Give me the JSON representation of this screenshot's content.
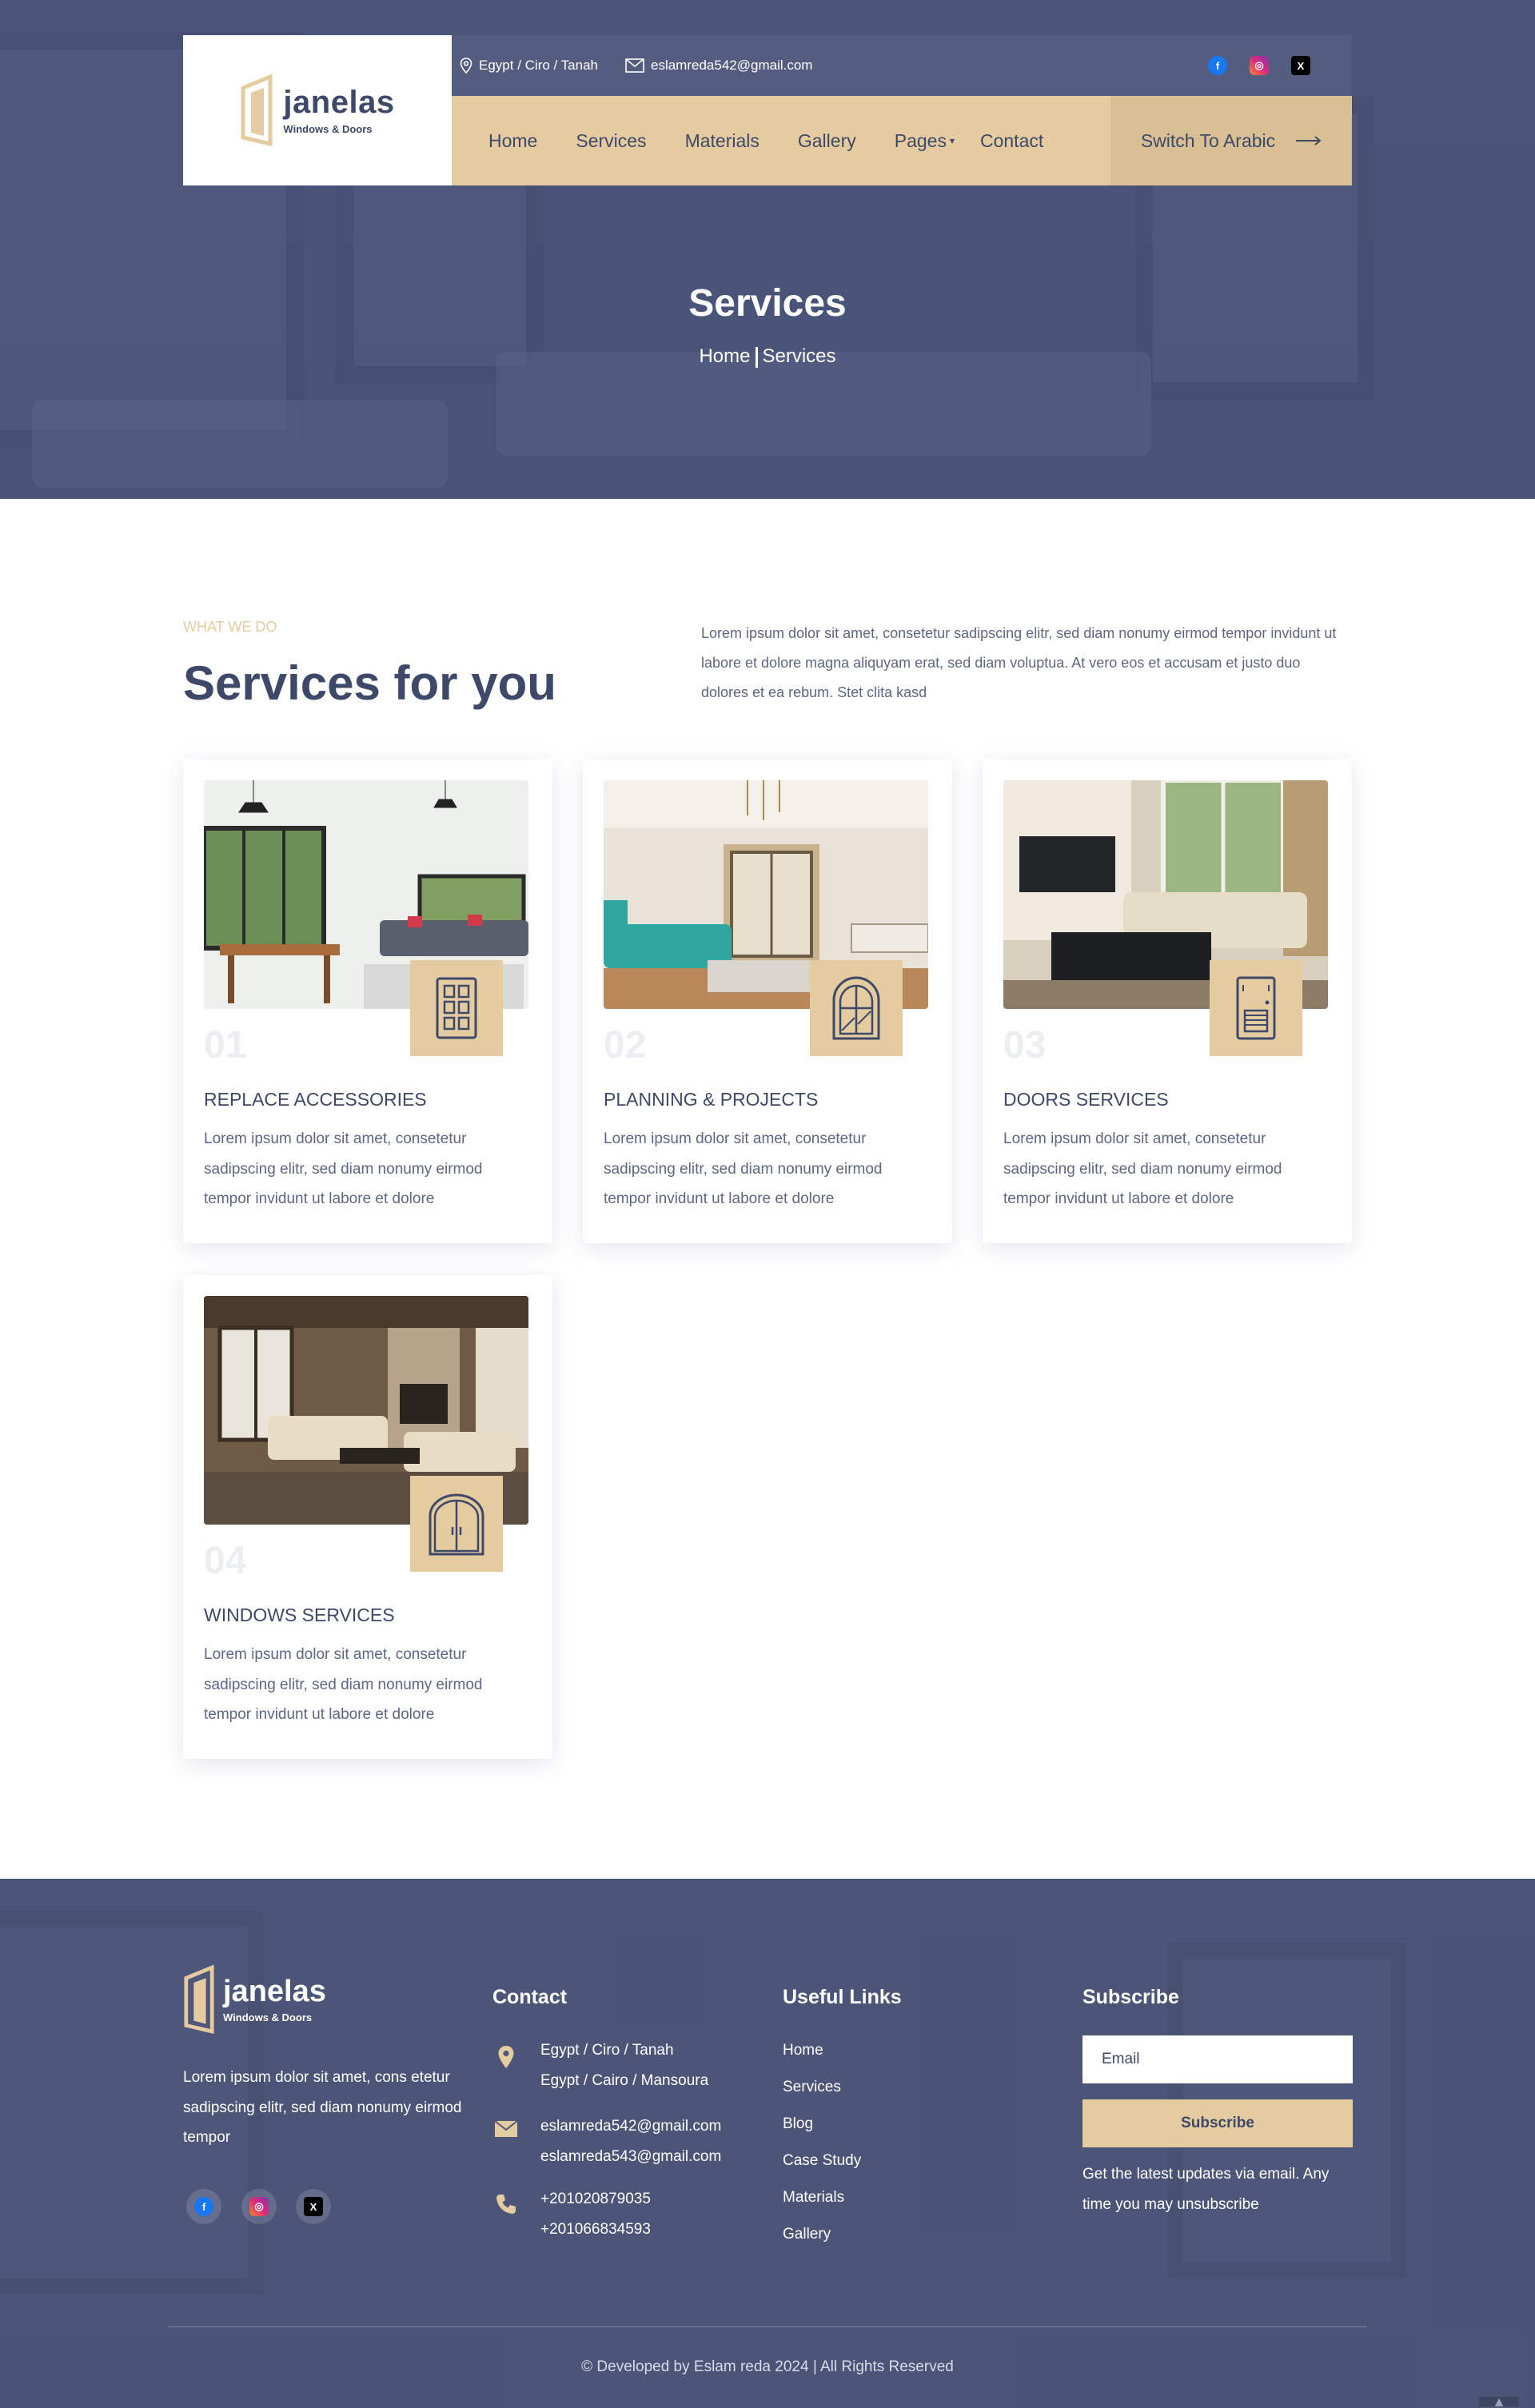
{
  "header": {
    "brand": {
      "name": "janelas",
      "tagline": "Windows & Doors"
    },
    "location": "Egypt / Ciro / Tanah",
    "email": "eslamreda542@gmail.com",
    "socials": [
      "facebook-icon",
      "instagram-icon",
      "x-icon"
    ],
    "nav": [
      {
        "label": "Home"
      },
      {
        "label": "Services"
      },
      {
        "label": "Materials"
      },
      {
        "label": "Gallery"
      },
      {
        "label": "Pages"
      },
      {
        "label": "Contact"
      }
    ],
    "switch_label": "Switch To Arabic"
  },
  "hero": {
    "title": "Services",
    "breadcrumb": {
      "home": "Home",
      "current": "Services"
    }
  },
  "intro": {
    "eyebrow": "WHAT WE DO",
    "title": "Services for you",
    "description": "Lorem ipsum dolor sit amet, consetetur sadipscing elitr, sed diam nonumy eirmod tempor invidunt ut labore et dolore magna aliquyam erat, sed diam voluptua. At vero eos et accusam et justo duo dolores et ea rebum. Stet clita kasd"
  },
  "services": [
    {
      "number": "01",
      "title": "REPLACE ACCESSORIES",
      "text": "Lorem ipsum dolor sit amet, consetetur sadipscing elitr, sed diam nonumy eirmod tempor invidunt ut labore et dolore",
      "icon": "panel-door-icon"
    },
    {
      "number": "02",
      "title": "PLANNING & PROJECTS",
      "text": "Lorem ipsum dolor sit amet, consetetur sadipscing elitr, sed diam nonumy eirmod tempor invidunt ut labore et dolore",
      "icon": "arched-window-icon"
    },
    {
      "number": "03",
      "title": "DOORS SERVICES",
      "text": "Lorem ipsum dolor sit amet, consetetur sadipscing elitr, sed diam nonumy eirmod tempor invidunt ut labore et dolore",
      "icon": "louver-door-icon"
    },
    {
      "number": "04",
      "title": "WINDOWS SERVICES",
      "text": "Lorem ipsum dolor sit amet, consetetur sadipscing elitr, sed diam nonumy eirmod tempor invidunt ut labore et dolore",
      "icon": "double-arched-door-icon"
    }
  ],
  "footer": {
    "brand": {
      "name": "janelas",
      "tagline": "Windows & Doors"
    },
    "about": "Lorem ipsum dolor sit amet, cons etetur sadipscing elitr, sed diam nonumy eirmod tempor",
    "contact": {
      "title": "Contact",
      "address1": "Egypt / Ciro / Tanah",
      "address2": "Egypt / Cairo / Mansoura",
      "email1": "eslamreda542@gmail.com",
      "email2": "eslamreda543@gmail.com",
      "phone1": "+201020879035",
      "phone2": "+201066834593"
    },
    "links": {
      "title": "Useful Links",
      "items": [
        "Home",
        "Services",
        "Blog",
        "Case Study",
        "Materials",
        "Gallery"
      ]
    },
    "subscribe": {
      "title": "Subscribe",
      "placeholder": "Email",
      "button": "Subscribe",
      "note": "Get the latest updates via email. Any time you may unsubscribe"
    },
    "copyright": "© Developed by Eslam reda  2024 | All Rights Reserved"
  },
  "colors": {
    "navy": "#3e4868",
    "gold": "#e5cca0",
    "hero_overlay": "#4f587c"
  }
}
